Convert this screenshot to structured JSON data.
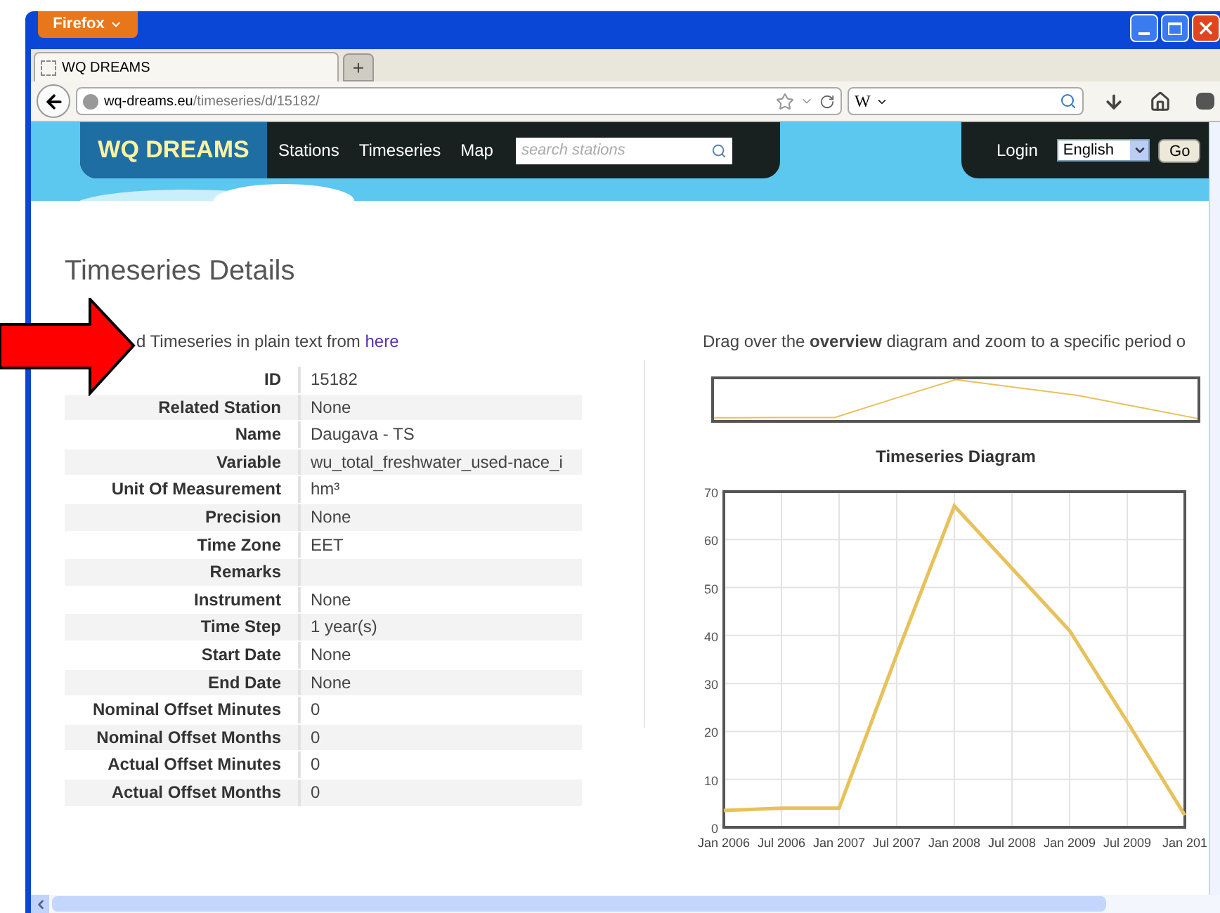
{
  "browser": {
    "menu_button": "Firefox",
    "tabs": [
      {
        "label": "WQ DREAMS",
        "selected": true
      }
    ],
    "new_tab": "+",
    "url": {
      "domain": "wq-dreams.eu",
      "path": "/timeseries/d/15182/"
    },
    "search_engine": "W"
  },
  "site": {
    "logo": "WQ DREAMS",
    "nav": [
      "Stations",
      "Timeseries",
      "Map"
    ],
    "search": {
      "placeholder": "search stations"
    },
    "login": "Login",
    "language": "English",
    "go": "Go"
  },
  "page": {
    "title": "Timeseries Details",
    "download_text": "d Timeseries in plain text from",
    "download_link": "here",
    "details": [
      {
        "label": "ID",
        "value": "15182"
      },
      {
        "label": "Related Station",
        "value": "None"
      },
      {
        "label": "Name",
        "value": "Daugava - TS"
      },
      {
        "label": "Variable",
        "value": "wu_total_freshwater_used-nace_i"
      },
      {
        "label": "Unit Of Measurement",
        "value": "hm³"
      },
      {
        "label": "Precision",
        "value": "None"
      },
      {
        "label": "Time Zone",
        "value": "EET"
      },
      {
        "label": "Remarks"
      },
      {
        "label": "Instrument",
        "value": "None"
      },
      {
        "label": "Time Step",
        "value": "1 year(s)"
      },
      {
        "label": "Start Date",
        "value": "None"
      },
      {
        "label": "End Date",
        "value": "None"
      },
      {
        "label": "Nominal Offset Minutes",
        "value": "0"
      },
      {
        "label": "Nominal Offset Months",
        "value": "0"
      },
      {
        "label": "Actual Offset Minutes",
        "value": "0"
      },
      {
        "label": "Actual Offset Months",
        "value": "0"
      }
    ],
    "drag_text": "Drag over the **overview** diagram and zoom to a specific period o",
    "chart_data": {
      "type": "line",
      "title": "Timeseries Diagram",
      "categories": [
        "Jan 2006",
        "Jul 2006",
        "Jan 2007",
        "Jul 2007",
        "Jan 2008",
        "Jul 2008",
        "Jan 2009",
        "Jul 2009",
        "Jan 201"
      ],
      "series": [
        {
          "color": "#e8c15a",
          "values": [
            3.5,
            4,
            4,
            36,
            67,
            54,
            41,
            22,
            2.5
          ]
        }
      ],
      "grid": true,
      "ylim": [
        0,
        70
      ],
      "yticks": [
        0,
        10,
        20,
        30,
        40,
        50,
        60,
        70
      ]
    }
  }
}
